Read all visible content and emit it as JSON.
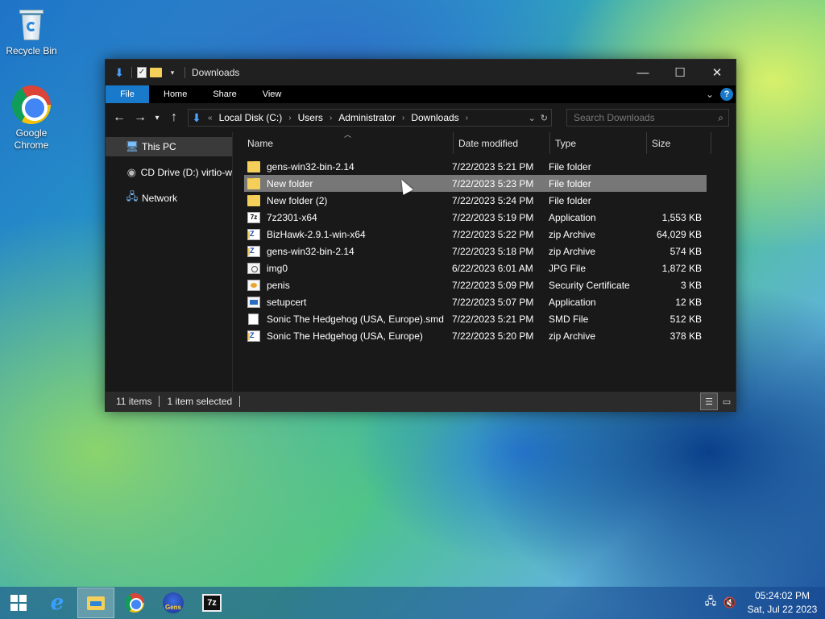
{
  "desktop": {
    "icons": [
      {
        "label": "Recycle Bin"
      },
      {
        "label": "Google Chrome"
      }
    ]
  },
  "window": {
    "title": "Downloads",
    "ribbon_tabs": [
      "File",
      "Home",
      "Share",
      "View"
    ],
    "address": {
      "prefix": "«",
      "crumbs": [
        "Local Disk (C:)",
        "Users",
        "Administrator",
        "Downloads"
      ]
    },
    "search_placeholder": "Search Downloads",
    "nav_items": [
      {
        "label": "This PC",
        "icon": "computer-icon"
      },
      {
        "label": "CD Drive (D:) virtio-w",
        "icon": "cd-drive-icon"
      },
      {
        "label": "Network",
        "icon": "network-icon"
      }
    ],
    "columns": {
      "name": "Name",
      "date": "Date modified",
      "type": "Type",
      "size": "Size"
    },
    "files": [
      {
        "name": "gens-win32-bin-2.14",
        "date": "7/22/2023 5:21 PM",
        "type": "File folder",
        "size": "",
        "icon": "folder"
      },
      {
        "name": "New folder",
        "date": "7/22/2023 5:23 PM",
        "type": "File folder",
        "size": "",
        "icon": "folder"
      },
      {
        "name": "New folder (2)",
        "date": "7/22/2023 5:24 PM",
        "type": "File folder",
        "size": "",
        "icon": "folder"
      },
      {
        "name": "7z2301-x64",
        "date": "7/22/2023 5:19 PM",
        "type": "Application",
        "size": "1,553 KB",
        "icon": "exe7z"
      },
      {
        "name": "BizHawk-2.9.1-win-x64",
        "date": "7/22/2023 5:22 PM",
        "type": "zip Archive",
        "size": "64,029 KB",
        "icon": "zip"
      },
      {
        "name": "gens-win32-bin-2.14",
        "date": "7/22/2023 5:18 PM",
        "type": "zip Archive",
        "size": "574 KB",
        "icon": "zip"
      },
      {
        "name": "img0",
        "date": "6/22/2023 6:01 AM",
        "type": "JPG File",
        "size": "1,872 KB",
        "icon": "img"
      },
      {
        "name": "penis",
        "date": "7/22/2023 5:09 PM",
        "type": "Security Certificate",
        "size": "3 KB",
        "icon": "cert"
      },
      {
        "name": "setupcert",
        "date": "7/22/2023 5:07 PM",
        "type": "Application",
        "size": "12 KB",
        "icon": "app"
      },
      {
        "name": "Sonic The Hedgehog (USA, Europe).smd",
        "date": "7/22/2023 5:21 PM",
        "type": "SMD File",
        "size": "512 KB",
        "icon": "doc"
      },
      {
        "name": "Sonic The Hedgehog (USA, Europe)",
        "date": "7/22/2023 5:20 PM",
        "type": "zip Archive",
        "size": "378 KB",
        "icon": "zip"
      }
    ],
    "selected_index": 1,
    "status": {
      "items": "11 items",
      "selected": "1 item selected"
    }
  },
  "taskbar": {
    "gens_label": "Gens",
    "sevenzip_label": "7z",
    "clock_time": "05:24:02 PM",
    "clock_date": "Sat, Jul 22 2023"
  }
}
